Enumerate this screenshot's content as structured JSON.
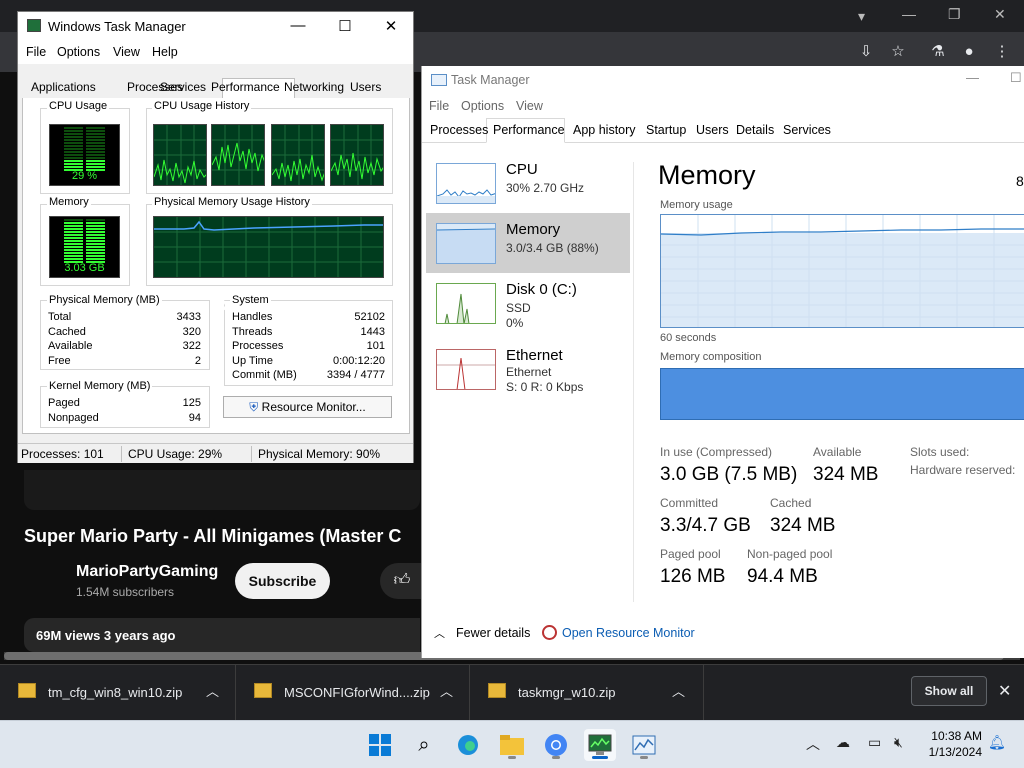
{
  "browser": {
    "video_title": "Super Mario Party - All Minigames (Master C",
    "channel_name": "MarioPartyGaming",
    "channel_subs": "1.54M subscribers",
    "subscribe_label": "Subscribe",
    "views_text": "69M views  3 years ago"
  },
  "downloads": {
    "items": [
      {
        "name": "tm_cfg_win8_win10.zip"
      },
      {
        "name": "MSCONFIGforWind....zip"
      },
      {
        "name": "taskmgr_w10.zip"
      }
    ],
    "show_all_label": "Show all"
  },
  "classic_tm": {
    "title": "Windows Task Manager",
    "menu": [
      "File",
      "Options",
      "View",
      "Help"
    ],
    "tabs": [
      "Applications",
      "Processes",
      "Services",
      "Performance",
      "Networking",
      "Users"
    ],
    "active_tab": "Performance",
    "cpu_usage_label": "CPU Usage",
    "cpu_usage_value": "29 %",
    "cpu_history_label": "CPU Usage History",
    "memory_label": "Memory",
    "memory_value": "3.03 GB",
    "phys_history_label": "Physical Memory Usage History",
    "physical_memory": {
      "label": "Physical Memory (MB)",
      "rows": [
        {
          "k": "Total",
          "v": "3433"
        },
        {
          "k": "Cached",
          "v": "320"
        },
        {
          "k": "Available",
          "v": "322"
        },
        {
          "k": "Free",
          "v": "2"
        }
      ]
    },
    "system": {
      "label": "System",
      "rows": [
        {
          "k": "Handles",
          "v": "52102"
        },
        {
          "k": "Threads",
          "v": "1443"
        },
        {
          "k": "Processes",
          "v": "101"
        },
        {
          "k": "Up Time",
          "v": "0:00:12:20"
        },
        {
          "k": "Commit (MB)",
          "v": "3394 / 4777"
        }
      ]
    },
    "kernel_memory": {
      "label": "Kernel Memory (MB)",
      "rows": [
        {
          "k": "Paged",
          "v": "125"
        },
        {
          "k": "Nonpaged",
          "v": "94"
        }
      ]
    },
    "resource_monitor_label": "Resource Monitor...",
    "status": {
      "processes": "Processes: 101",
      "cpu": "CPU Usage: 29%",
      "memory": "Physical Memory: 90%"
    },
    "cpu_usage_fraction": 0.29,
    "memory_fraction": 0.9
  },
  "modern_tm": {
    "title": "Task Manager",
    "menu": [
      "File",
      "Options",
      "View"
    ],
    "tabs": [
      "Processes",
      "Performance",
      "App history",
      "Startup",
      "Users",
      "Details",
      "Services"
    ],
    "active_tab": "Performance",
    "resources": [
      {
        "name": "CPU",
        "line1": "30%  2.70 GHz",
        "line2": ""
      },
      {
        "name": "Memory",
        "line1": "3.0/3.4 GB (88%)",
        "line2": ""
      },
      {
        "name": "Disk 0 (C:)",
        "line1": "SSD",
        "line2": "0%"
      },
      {
        "name": "Ethernet",
        "line1": "Ethernet",
        "line2": "S: 0 R: 0 Kbps"
      }
    ],
    "heading": "Memory",
    "heading_right": "8",
    "memory_usage_label": "Memory usage",
    "seconds_label": "60 seconds",
    "composition_label": "Memory composition",
    "stats": {
      "in_use_label": "In use (Compressed)",
      "in_use_value": "3.0 GB (7.5 MB)",
      "available_label": "Available",
      "available_value": "324 MB",
      "slots_label": "Slots used:",
      "hw_reserved_label": "Hardware reserved:",
      "committed_label": "Committed",
      "committed_value": "3.3/4.7 GB",
      "cached_label": "Cached",
      "cached_value": "324 MB",
      "paged_label": "Paged pool",
      "paged_value": "126 MB",
      "nonpaged_label": "Non-paged pool",
      "nonpaged_value": "94.4 MB"
    },
    "fewer_details_label": "Fewer details",
    "open_resmon_label": "Open Resource Monitor"
  },
  "taskbar": {
    "time": "10:38 AM",
    "date": "1/13/2024"
  },
  "colors": {
    "meter_green": "#33ff33",
    "history_bg": "#003c1e",
    "modern_accent": "#4d8fe0",
    "link_blue": "#0b5db3"
  }
}
